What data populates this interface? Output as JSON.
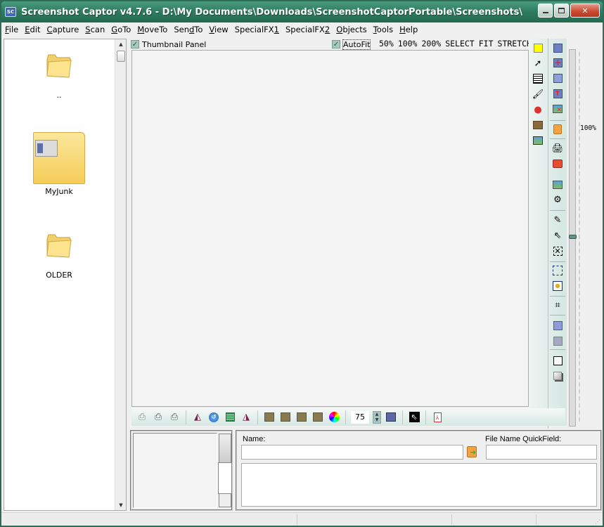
{
  "window": {
    "title": "Screenshot Captor v4.7.6 - D:\\My Documents\\Downloads\\ScreenshotCaptorPortable\\Screenshots\\",
    "app_icon": "SC",
    "controls": {
      "minimize": "minimize-icon",
      "maximize": "maximize-icon",
      "close": "close-icon"
    }
  },
  "menu": [
    {
      "label": "File",
      "accel": "F"
    },
    {
      "label": "Edit",
      "accel": "E"
    },
    {
      "label": "Capture",
      "accel": "C"
    },
    {
      "label": "Scan",
      "accel": "S"
    },
    {
      "label": "GoTo",
      "accel": "G"
    },
    {
      "label": "MoveTo",
      "accel": "M"
    },
    {
      "label": "SendTo",
      "accel": "d"
    },
    {
      "label": "View",
      "accel": "V"
    },
    {
      "label": "SpecialFX1",
      "accel": "1"
    },
    {
      "label": "SpecialFX2",
      "accel": "2"
    },
    {
      "label": "Objects",
      "accel": "O"
    },
    {
      "label": "Tools",
      "accel": "T"
    },
    {
      "label": "Help",
      "accel": "H"
    }
  ],
  "file_browser": {
    "items": [
      {
        "label": "..",
        "icon": "folder-icon"
      },
      {
        "label": "MyJunk",
        "icon": "folder-with-thumbnail-icon"
      },
      {
        "label": "OLDER",
        "icon": "folder-icon"
      }
    ]
  },
  "options": {
    "thumbnail_panel": {
      "label": "Thumbnail Panel",
      "checked": true
    },
    "autofit": {
      "label": "AutoFit",
      "checked": true
    },
    "zoom_links": [
      "50%",
      "100%",
      "200%",
      "SELECT",
      "FIT",
      "STRETCH"
    ]
  },
  "right_toolbar": {
    "column1": [
      "color-swatch-icon",
      "arrow-icon",
      "text-box-icon",
      "brush-icon",
      "shapes-icon",
      "multi-image-icon",
      "image-ruler-icon"
    ],
    "column2": [
      "save-icon",
      "save-new-icon",
      "edit-save-icon",
      "rename-icon",
      "delete-image-icon",
      "clipboard-icon",
      "print-icon",
      "toolbox-icon",
      "image-editor-icon",
      "gears-icon",
      "wand-icon",
      "pointer-icon",
      "deselect-icon",
      "select-region-icon",
      "select-object-icon",
      "crop-icon",
      "window-icon",
      "window-alt-icon",
      "grid-icon",
      "shadow-icon"
    ],
    "swatch_color": "#ffff00"
  },
  "zoom_slider": {
    "readout": "100%",
    "value_percent": 100
  },
  "bottom_toolbar": {
    "spin_value": "75",
    "icons": [
      "scan-icon",
      "scan-text-icon",
      "scan-ocr-icon",
      "flip-left-icon",
      "rotate-icon",
      "list-icon",
      "flip-right-icon",
      "paste-image-1-icon",
      "paste-image-2-icon",
      "paste-image-3-icon",
      "paste-image-4-icon",
      "color-wheel-icon",
      "spin-up-icon",
      "spin-down-icon",
      "quality-icon",
      "cursor-icon",
      "pdf-icon"
    ]
  },
  "info_panel": {
    "name_label": "Name:",
    "name_value": "",
    "quickfield_label": "File Name QuickField:",
    "quickfield_value": "",
    "comment_value": ""
  }
}
